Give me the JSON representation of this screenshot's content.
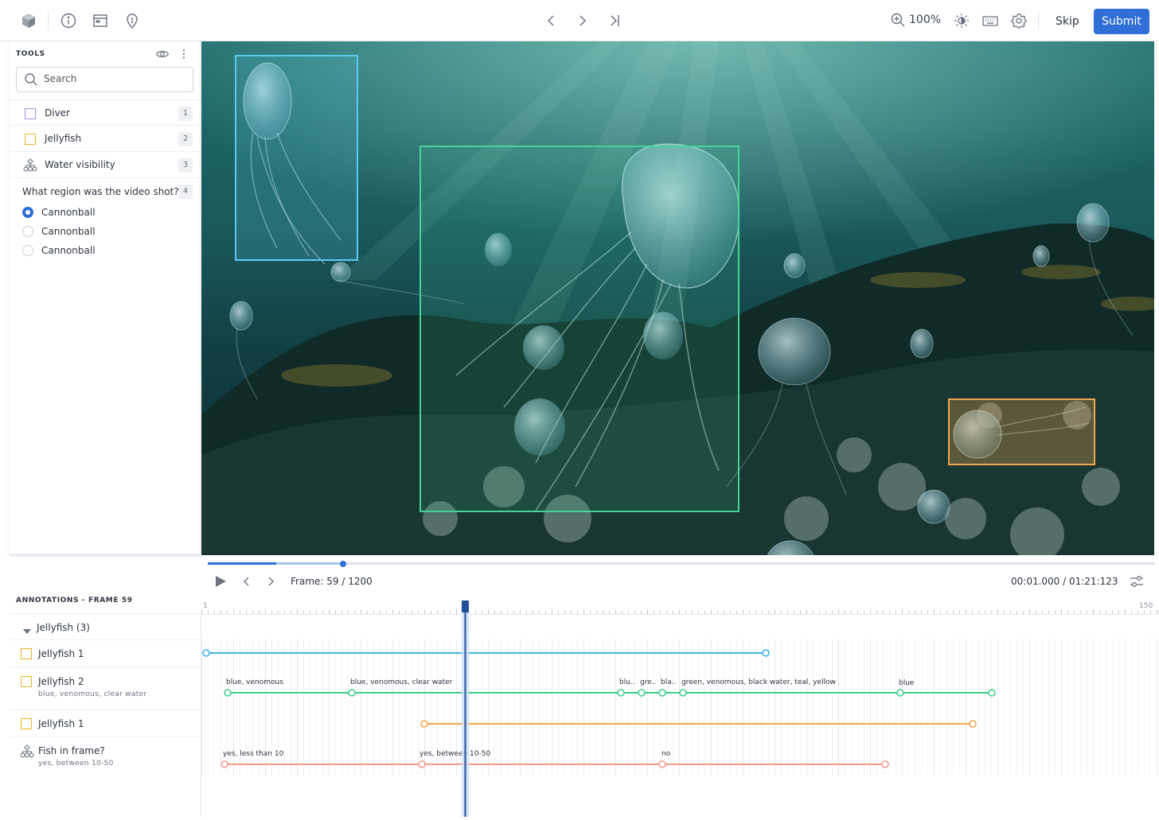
{
  "toolbar": {
    "zoom": "100%",
    "skip_label": "Skip",
    "submit_label": "Submit"
  },
  "tools": {
    "title": "TOOLS",
    "search_placeholder": "Search",
    "items": [
      {
        "label": "Diver",
        "shortcut": "1",
        "color": "#a78bde"
      },
      {
        "label": "Jellyfish",
        "shortcut": "2",
        "color": "#e8b923"
      },
      {
        "label": "Water visibility",
        "shortcut": "3"
      }
    ],
    "question": {
      "label": "What region was the video shot?",
      "shortcut": "4",
      "options": [
        {
          "label": "Cannonball",
          "selected": true
        },
        {
          "label": "Cannonball",
          "selected": false
        },
        {
          "label": "Cannonball",
          "selected": false
        }
      ]
    }
  },
  "player": {
    "frame_text": "Frame: 59 / 1200",
    "time_text": "00:01.000 / 01:21:123"
  },
  "annotations": {
    "title": "ANNOTATIONS - FRAME 59",
    "group_label": "Jellyfish (3)",
    "rows": [
      {
        "name": "Jellyfish 1",
        "sub": ""
      },
      {
        "name": "Jellyfish 2",
        "sub": "blue, venomous, clear water"
      },
      {
        "name": "Jellyfish 1",
        "sub": ""
      },
      {
        "name": "Fish in frame?",
        "sub": "yes, between 10-50"
      }
    ]
  },
  "timeline": {
    "start_label": "1",
    "end_label": "150",
    "tracks": [
      {
        "color": "#3fb6e8",
        "keyframes": [],
        "labels": []
      },
      {
        "color": "#3ecf8e",
        "labels": [
          "blue, venomous",
          "blue, venomous, clear water",
          "blu..",
          "gre..",
          "bla..",
          "green, venomous, black water, teal, yellow",
          "blue"
        ]
      },
      {
        "color": "#f2a64e",
        "labels": []
      },
      {
        "color": "#f39b8f",
        "labels": [
          "yes, less than 10",
          "yes, between 10-50",
          "no"
        ]
      }
    ]
  },
  "colors": {
    "accent": "#2f6fd6",
    "box_cyan": "#5ccbf0",
    "box_green": "#46d39a",
    "box_orange": "#f2a64e"
  }
}
